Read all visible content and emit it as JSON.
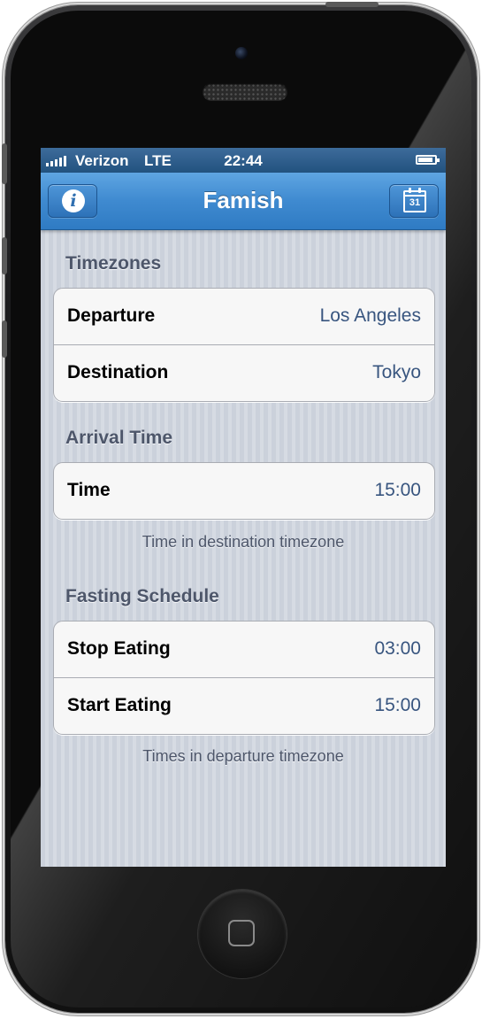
{
  "status_bar": {
    "carrier": "Verizon",
    "network": "LTE",
    "time": "22:44",
    "battery_level": 0.9
  },
  "nav_bar": {
    "title": "Famish",
    "info_icon": "i",
    "calendar_icon_day": "31"
  },
  "sections": {
    "timezones": {
      "header": "Timezones",
      "rows": [
        {
          "label": "Departure",
          "value": "Los Angeles"
        },
        {
          "label": "Destination",
          "value": "Tokyo"
        }
      ]
    },
    "arrival": {
      "header": "Arrival Time",
      "rows": [
        {
          "label": "Time",
          "value": "15:00"
        }
      ],
      "footer": "Time in destination timezone"
    },
    "fasting": {
      "header": "Fasting Schedule",
      "rows": [
        {
          "label": "Stop Eating",
          "value": "03:00"
        },
        {
          "label": "Start Eating",
          "value": "15:00"
        }
      ],
      "footer": "Times in departure timezone"
    }
  },
  "colors": {
    "nav_blue": "#3f8ad0",
    "value_text": "#38557f",
    "section_header": "#4d566a"
  }
}
